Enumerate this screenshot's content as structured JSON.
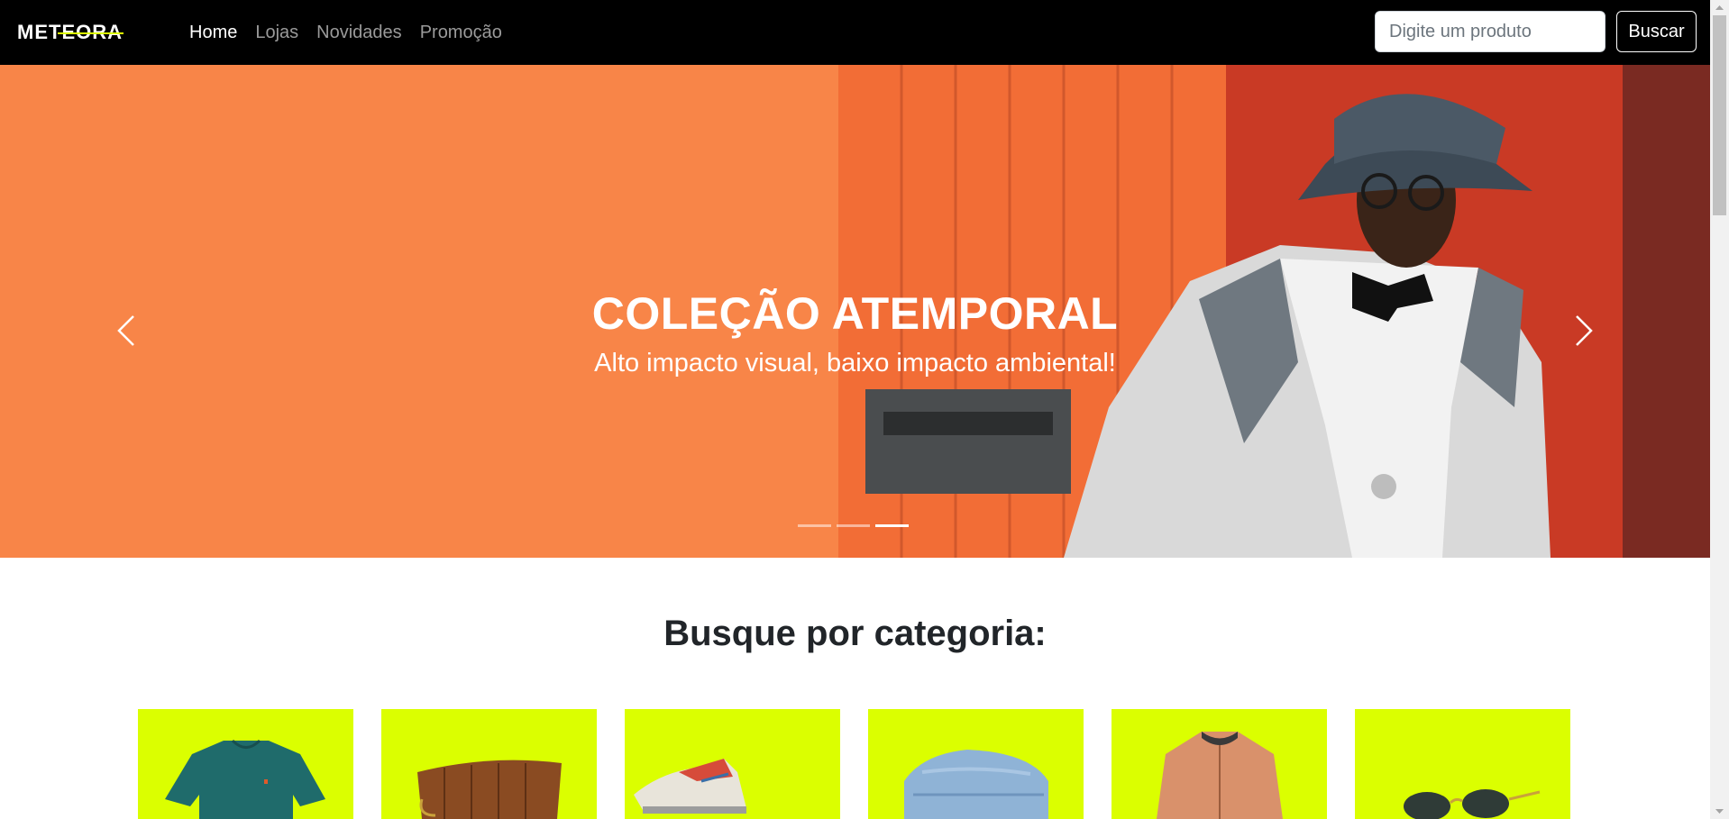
{
  "navbar": {
    "logo_text": "METEORA",
    "links": [
      {
        "label": "Home",
        "active": true
      },
      {
        "label": "Lojas",
        "active": false
      },
      {
        "label": "Novidades",
        "active": false
      },
      {
        "label": "Promoção",
        "active": false
      }
    ],
    "search": {
      "placeholder": "Digite um produto",
      "value": ""
    },
    "search_button": "Buscar"
  },
  "hero": {
    "title": "COLEÇÃO ATEMPORAL",
    "subtitle": "Alto impacto visual, baixo impacto ambiental!",
    "slide_count": 3,
    "active_slide": 3
  },
  "categories": {
    "title": "Busque por categoria:",
    "items": [
      {
        "icon": "tshirt-icon"
      },
      {
        "icon": "bag-icon"
      },
      {
        "icon": "sneaker-icon"
      },
      {
        "icon": "jeans-icon"
      },
      {
        "icon": "jacket-icon"
      },
      {
        "icon": "sunglasses-icon"
      }
    ]
  },
  "colors": {
    "navbar_bg": "#000000",
    "hero_bg": "#f88548",
    "category_bg": "#dbff00"
  }
}
